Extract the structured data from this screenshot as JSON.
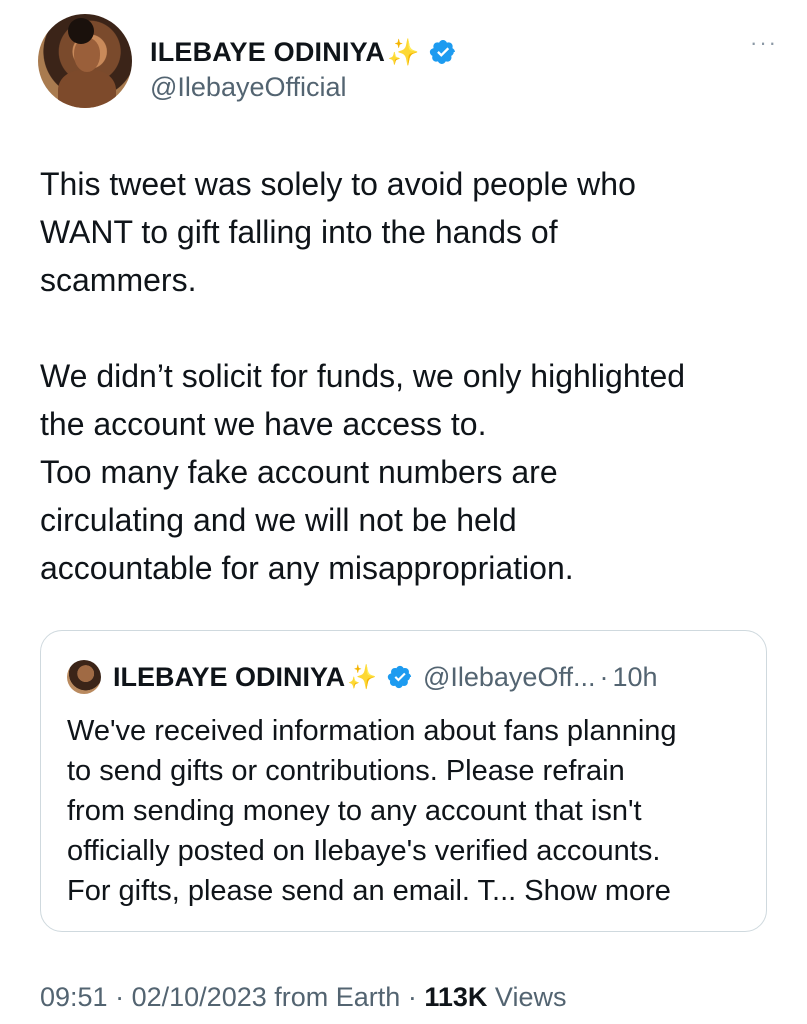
{
  "author": {
    "display_name": "ILEBAYE ODINIYA",
    "sparkle": "✨",
    "handle": "@IlebayeOfficial",
    "more": "···"
  },
  "tweet": {
    "paragraph1": "This tweet was solely to avoid people who\nWANT to gift falling into the hands of\nscammers.",
    "paragraph2": "We didn’t solicit for funds, we only highlighted\nthe account we have access to.\nToo many fake account numbers are\ncirculating and we will not be held\naccountable for any misappropriation."
  },
  "quoted": {
    "display_name": "ILEBAYE ODINIYA",
    "sparkle": "✨",
    "handle": "@IlebayeOff...",
    "separator": "·",
    "time": "10h",
    "text": "We've received information about fans planning\nto send gifts or contributions. Please refrain\nfrom sending money to any account that isn't\nofficially posted on Ilebaye's verified accounts.\nFor gifts, please send an email. T...",
    "show_more": "Show more"
  },
  "meta": {
    "time": "09:51",
    "sep1": "·",
    "date": "02/10/2023",
    "source": "from Earth",
    "sep2": "·",
    "views_count": "113K",
    "views_label": "Views"
  },
  "colors": {
    "verified": "#1d9bf0",
    "muted": "#536471",
    "text": "#0f1419",
    "border": "#cfd9de"
  }
}
